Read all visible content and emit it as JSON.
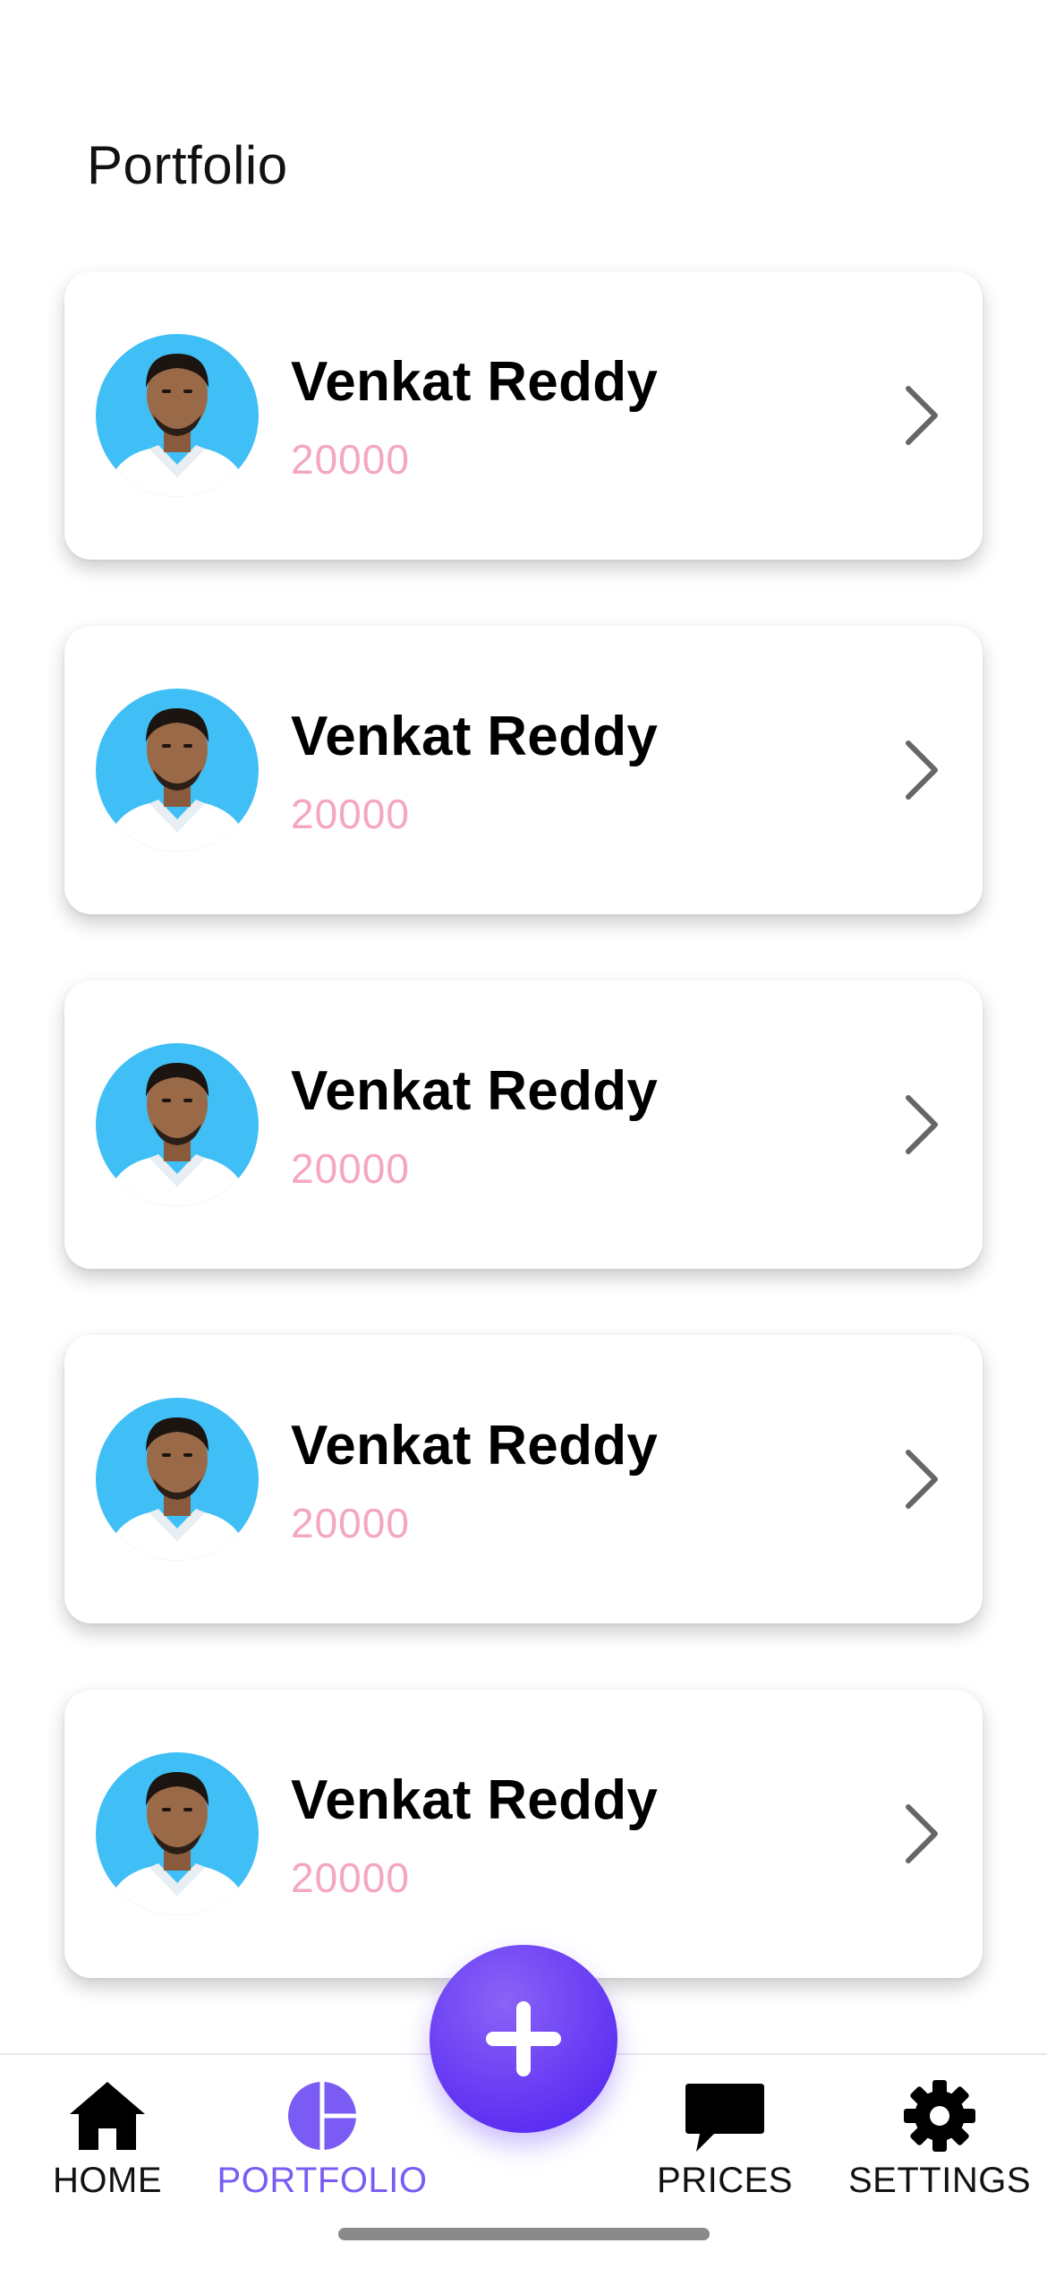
{
  "header": {
    "title": "Portfolio"
  },
  "portfolio_items": [
    {
      "name": "Venkat Reddy",
      "amount": "20000",
      "avatar": "person-photo"
    },
    {
      "name": "Venkat Reddy",
      "amount": "20000",
      "avatar": "person-photo"
    },
    {
      "name": "Venkat Reddy",
      "amount": "20000",
      "avatar": "person-photo"
    },
    {
      "name": "Venkat Reddy",
      "amount": "20000",
      "avatar": "person-photo"
    },
    {
      "name": "Venkat Reddy",
      "amount": "20000",
      "avatar": "person-photo"
    }
  ],
  "fab": {
    "icon": "plus-icon"
  },
  "tabbar": {
    "tabs": [
      {
        "label": "HOME",
        "icon": "home-icon",
        "active": false
      },
      {
        "label": "PORTFOLIO",
        "icon": "pie-chart-icon",
        "active": true
      },
      {
        "label": "PRICES",
        "icon": "chat-bubble-icon",
        "active": false
      },
      {
        "label": "SETTINGS",
        "icon": "gear-icon",
        "active": false
      }
    ]
  },
  "colors": {
    "accent": "#7a5cf4",
    "amount": "#f4a7bd",
    "avatar_background": "#3fbff5",
    "fab_gradient": [
      "#8a63f7",
      "#5d2ff2"
    ]
  }
}
